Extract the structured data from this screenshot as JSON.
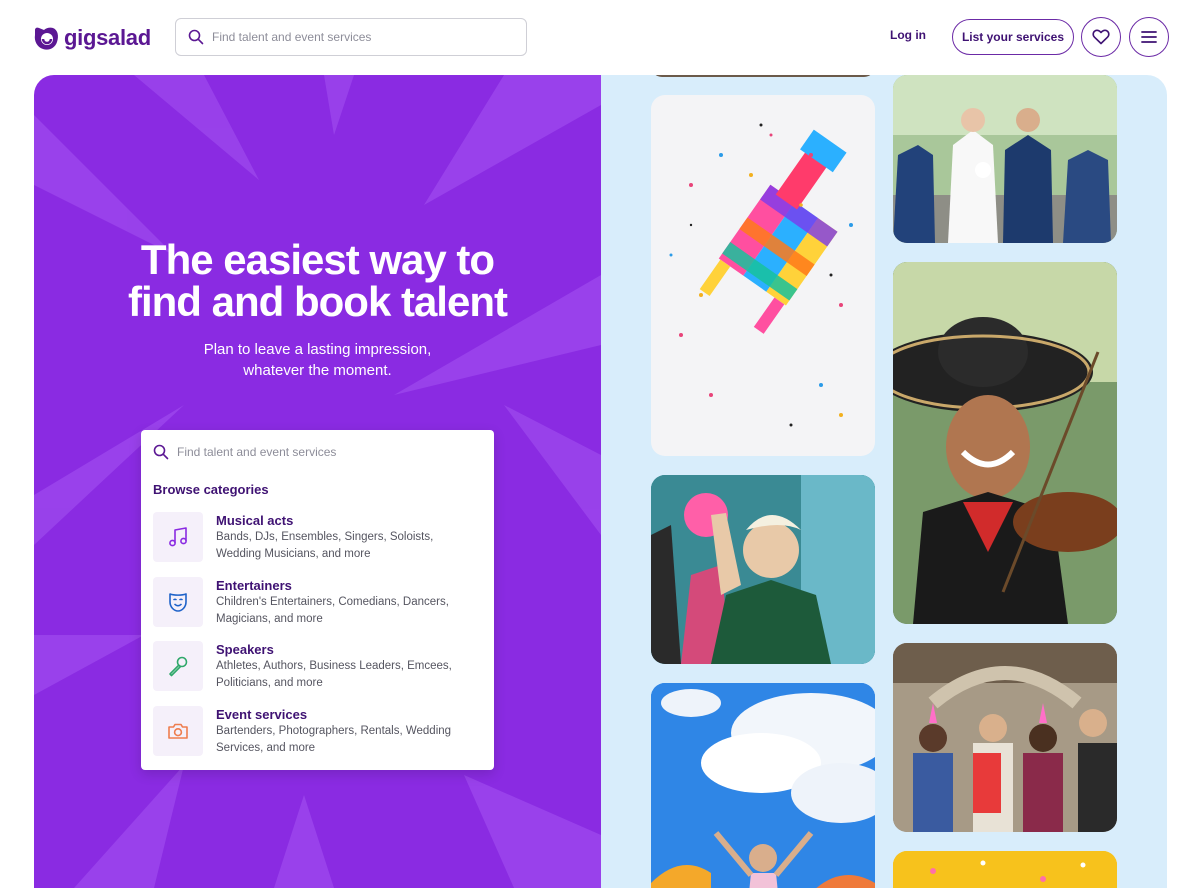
{
  "header": {
    "logo_text": "gigsalad",
    "search_placeholder": "Find talent and event services",
    "login_label": "Log in",
    "list_services_label": "List your services",
    "favorites_icon": "heart-icon",
    "menu_icon": "hamburger-menu-icon"
  },
  "hero": {
    "headline_line1": "The easiest way to",
    "headline_line2": "find and book talent",
    "subline_line1": "Plan to leave a lasting impression,",
    "subline_line2": "whatever the moment.",
    "background_color": "#8a2be2"
  },
  "card": {
    "search_placeholder": "Find talent and event services",
    "browse_label": "Browse categories",
    "categories": [
      {
        "title": "Musical acts",
        "description": "Bands, DJs, Ensembles, Singers, Soloists, Wedding Musicians, and more",
        "icon": "music-note-icon"
      },
      {
        "title": "Entertainers",
        "description": "Children's Entertainers, Comedians, Dancers, Magicians, and more",
        "icon": "theater-mask-icon"
      },
      {
        "title": "Speakers",
        "description": "Athletes, Authors, Business Leaders, Emcees, Politicians, and more",
        "icon": "microphone-icon"
      },
      {
        "title": "Event services",
        "description": "Bartenders, Photographers, Rentals, Wedding Services, and more",
        "icon": "camera-icon"
      }
    ]
  },
  "collage": {
    "background_color": "#d8edfb",
    "tiles": [
      {
        "name": "pinata-photo"
      },
      {
        "name": "wedding-photo"
      },
      {
        "name": "mariachi-violinist-photo"
      },
      {
        "name": "dancing-party-photo"
      },
      {
        "name": "birthday-party-photo"
      },
      {
        "name": "bounce-house-sky-photo"
      },
      {
        "name": "confetti-photo"
      }
    ]
  }
}
